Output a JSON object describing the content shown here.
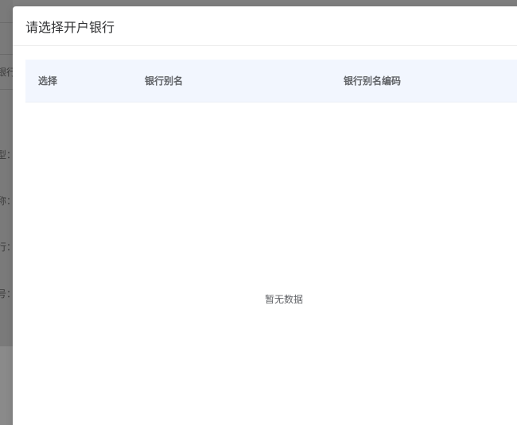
{
  "background": {
    "fragments": [
      "银行",
      "型：",
      "称：",
      "行：",
      "号："
    ]
  },
  "dialog": {
    "title": "请选择开户银行",
    "table": {
      "columns": [
        "选择",
        "银行别名",
        "银行别名编码"
      ],
      "rows": [],
      "empty_text": "暂无数据"
    }
  }
}
